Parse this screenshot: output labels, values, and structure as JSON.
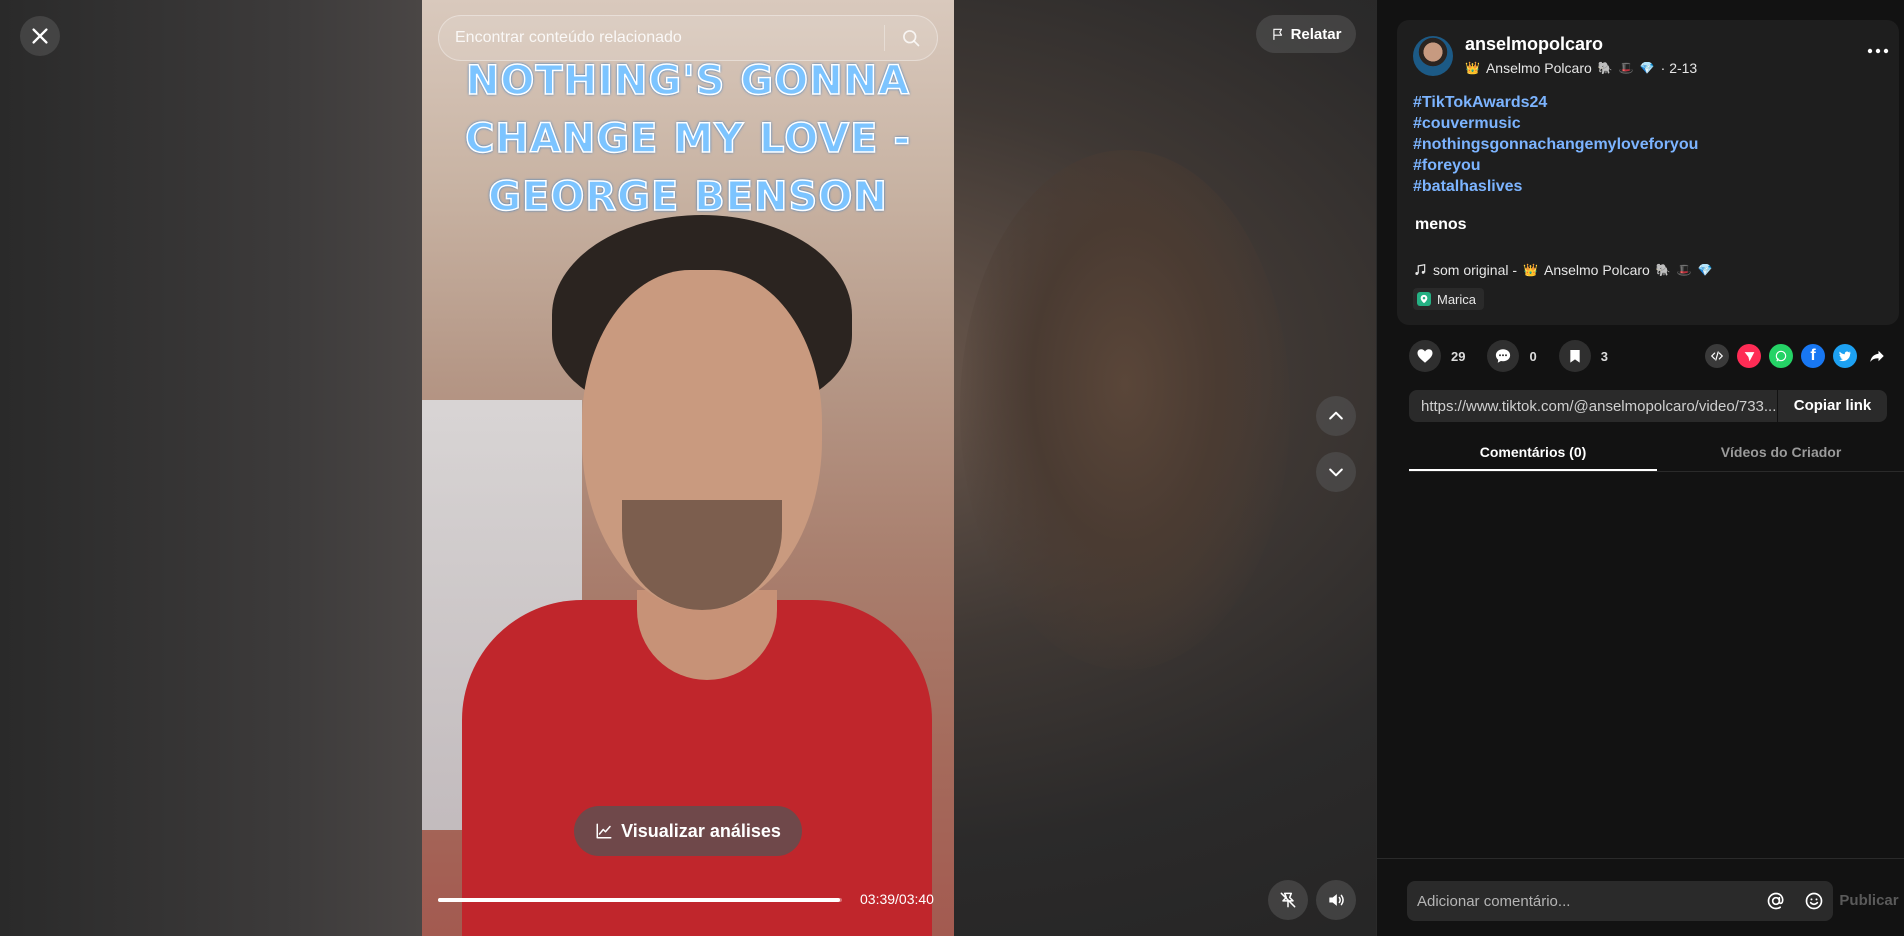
{
  "search": {
    "placeholder": "Encontrar conteúdo relacionado"
  },
  "header": {
    "report_label": "Relatar"
  },
  "video": {
    "title_overlay": "NOTHING'S GONNA\nCHANGE MY LOVE  -\nGEORGE BENSON",
    "analytics_label": "Visualizar análises",
    "time": "03:39/03:40",
    "progress_fraction": 0.995
  },
  "author": {
    "username": "anselmopolcaro",
    "crown_icon": "👑",
    "display_name": "Anselmo Polcaro",
    "badges": [
      "🐘",
      "🎩",
      "💎"
    ],
    "date": "· 2-13"
  },
  "description": {
    "hashtags": [
      "#TikTokAwards24",
      "#couvermusic",
      "#nothingsgonnachangemyloveforyou",
      "#foreyou",
      "#batalhaslives"
    ],
    "less_label": "menos"
  },
  "music": {
    "label": "som original -",
    "artist": "Anselmo Polcaro",
    "badges": [
      "🐘",
      "🎩",
      "💎"
    ]
  },
  "location": {
    "label": "Marica"
  },
  "stats": {
    "likes": "29",
    "comments": "0",
    "saves": "3"
  },
  "share": {
    "services": [
      "embed",
      "send",
      "whatsapp",
      "facebook",
      "twitter",
      "share"
    ],
    "url": "https://www.tiktok.com/@anselmopolcaro/video/733...",
    "copy_label": "Copiar link"
  },
  "tabs": {
    "comments": "Comentários (0)",
    "creator_videos": "Vídeos do Criador"
  },
  "comment_box": {
    "placeholder": "Adicionar comentário...",
    "publish_label": "Publicar"
  },
  "colors": {
    "accent_link": "#7cb4ff",
    "background": "#121212",
    "card": "#1e1e1e"
  }
}
